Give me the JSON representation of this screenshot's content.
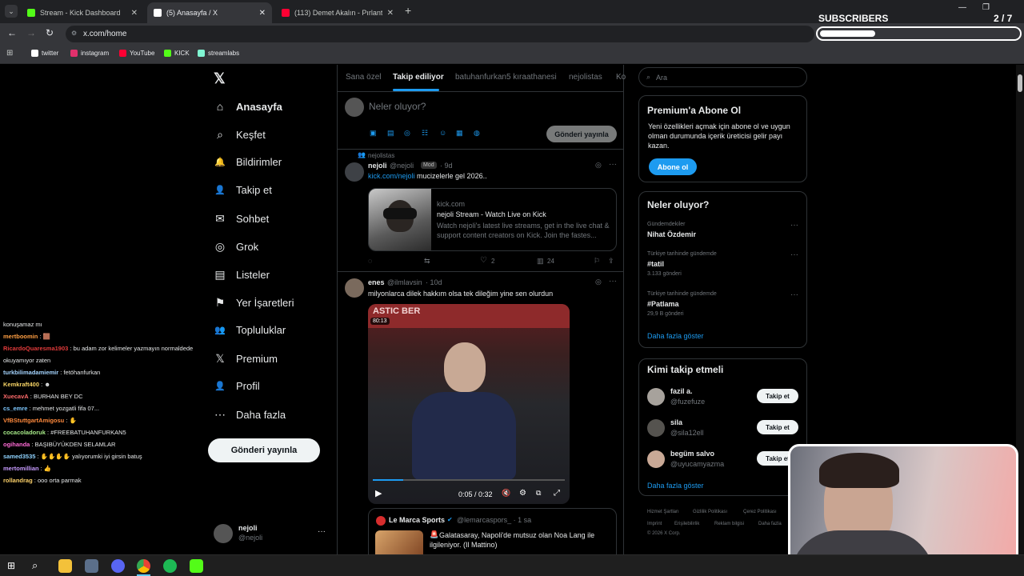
{
  "browser": {
    "tabs": [
      {
        "title": "Stream - Kick Dashboard",
        "favicon_color": "#53fc18",
        "close": "✕"
      },
      {
        "title": "(5) Anasayfa / X",
        "favicon_color": "#ffffff",
        "close": "✕"
      },
      {
        "title": "(113) Demet Akalın - Pırlanta -",
        "favicon_color": "#ff0033",
        "close": "✕"
      }
    ],
    "new_tab": "+",
    "url": "x.com/home",
    "bookmarks": [
      {
        "label": "twitter",
        "color": "#ffffff"
      },
      {
        "label": "instagram",
        "color": "#e1306c"
      },
      {
        "label": "YouTube",
        "color": "#ff0033"
      },
      {
        "label": "KICK",
        "color": "#53fc18"
      },
      {
        "label": "streamlabs",
        "color": "#80f5d2"
      }
    ]
  },
  "overlay": {
    "subscribers_label": "SUBSCRIBERS",
    "subscribers_count": "2 / 7",
    "subscribers_progress": 0.28
  },
  "sidebar": {
    "logo": "𝕏",
    "items": [
      {
        "label": "Anasayfa",
        "icon": "⌂"
      },
      {
        "label": "Keşfet",
        "icon": "⌕"
      },
      {
        "label": "Bildirimler",
        "icon": "🔔"
      },
      {
        "label": "Takip et",
        "icon": "👤"
      },
      {
        "label": "Sohbet",
        "icon": "✉"
      },
      {
        "label": "Grok",
        "icon": "◎"
      },
      {
        "label": "Listeler",
        "icon": "▤"
      },
      {
        "label": "Yer İşaretleri",
        "icon": "⚑"
      },
      {
        "label": "Topluluklar",
        "icon": "👥"
      },
      {
        "label": "Premium",
        "icon": "𝕏"
      },
      {
        "label": "Profil",
        "icon": "👤"
      },
      {
        "label": "Daha fazla",
        "icon": "⋯"
      }
    ],
    "post_button": "Gönderi yayınla",
    "account": {
      "name": "nejoli",
      "handle": "@nejoli",
      "more": "···"
    }
  },
  "timeline": {
    "tabs": [
      "Sana özel",
      "Takip ediliyor",
      "batuhanfurkan5 kıraathanesi",
      "nejolistas",
      "Ko"
    ],
    "compose_placeholder": "Neler oluyor?",
    "compose_button": "Gönderi yayınla",
    "posts": [
      {
        "context": "nejolistas",
        "author": "nejoli",
        "handle": "@nejoli",
        "badge": "Mod",
        "time": "· 9d",
        "link_text": "kick.com/nejoli",
        "text": " mucizelerle gel 2026..",
        "card_domain": "kick.com",
        "card_title": "nejoli Stream - Watch Live on Kick",
        "card_desc": "Watch nejoli's latest live streams, get in the live chat & support content creators on Kick. Join the fastes...",
        "likes": "2",
        "views": "24"
      },
      {
        "author": "enes",
        "handle": "@ilmlavsin",
        "time": "· 10d",
        "text": "milyonlarca dilek hakkım olsa tek dileğim yine sen olurdun",
        "video_tag": "80:13",
        "video_time": "0:05 / 0:32",
        "quote_author": "Le Marca Sports",
        "quote_handle": "@lemarcaspors_ · 1 sa",
        "quote_text": "Galatasaray, Napoli'de mutsuz olan Noa Lang ile ilgileniyor. (Il Mattino)"
      }
    ]
  },
  "right": {
    "search_placeholder": "Ara",
    "premium": {
      "title": "Premium'a Abone Ol",
      "text": "Yeni özellikleri açmak için abone ol ve uygun olman durumunda içerik üreticisi gelir payı kazan.",
      "button": "Abone ol"
    },
    "trends": {
      "title": "Neler oluyor?",
      "items": [
        {
          "category": "Gündemdekiler",
          "name": "Nihat Özdemir",
          "count": ""
        },
        {
          "category": "Türkiye tarihinde gündemde",
          "name": "#tatil",
          "count": "3.133 gönderi"
        },
        {
          "category": "Türkiye tarihinde gündemde",
          "name": "#Patlama",
          "count": "29,9 B gönderi"
        }
      ],
      "show_more": "Daha fazla göster"
    },
    "who_to_follow": {
      "title": "Kimi takip etmeli",
      "items": [
        {
          "name": "fazil a.",
          "handle": "@fuzefuze",
          "button": "Takip et"
        },
        {
          "name": "sila",
          "handle": "@sila12ell",
          "button": "Takip et"
        },
        {
          "name": "begüm salvo",
          "handle": "@uyucamyazma",
          "button": "Takip et"
        }
      ],
      "show_more": "Daha fazla göster"
    },
    "footer": {
      "links": [
        "Hizmet Şartları",
        "Gizlilik Politikası",
        "Çerez Politikası",
        "Imprint",
        "Erişilebilirlik",
        "Reklam bilgisi",
        "Daha fazla"
      ],
      "copyright": "© 2026 X Corp."
    }
  },
  "chat": [
    {
      "user": "",
      "color": "#e7e9ea",
      "msg": "konuşamaz mı"
    },
    {
      "user": "mertboomin",
      "color": "#ff9f43",
      "msg": "🟫"
    },
    {
      "user": "RicardoQuaresma1903",
      "color": "#e33b3b",
      "msg": "bu adam zor kelimeler yazmayın normaldede"
    },
    {
      "user": "",
      "color": "#e7e9ea",
      "msg": "okuyamıyor zaten"
    },
    {
      "user": "turkbilimadamiemir",
      "color": "#a4d4ff",
      "msg": "fetöhanfurkan"
    },
    {
      "user": "Kemkraft400",
      "color": "#f6d365",
      "msg": "☻"
    },
    {
      "user": "XuecavA",
      "color": "#ff6b6b",
      "msg": "BURHAN BEY DC"
    },
    {
      "user": "cs_emre",
      "color": "#7ec8ff",
      "msg": "mehmet yozgatli fifa 07..."
    },
    {
      "user": "VfBStuttgartAmigosu",
      "color": "#ff8a3d",
      "msg": "✋"
    },
    {
      "user": "cocacoladoruk",
      "color": "#a5e887",
      "msg": "#FREEBATUHANFURKAN5"
    },
    {
      "user": "ogihanda",
      "color": "#ff6bd5",
      "msg": "BAŞIBÜYÜKDEN SELAMLAR"
    },
    {
      "user": "samed3535",
      "color": "#8fd3ff",
      "msg": "✋✋✋✋ yalıyorumki iyi girsin batuş"
    },
    {
      "user": "mertomillian",
      "color": "#c79bff",
      "msg": "👍"
    },
    {
      "user": "rollandrag",
      "color": "#ffd36b",
      "msg": "ooo orta parmak"
    }
  ]
}
